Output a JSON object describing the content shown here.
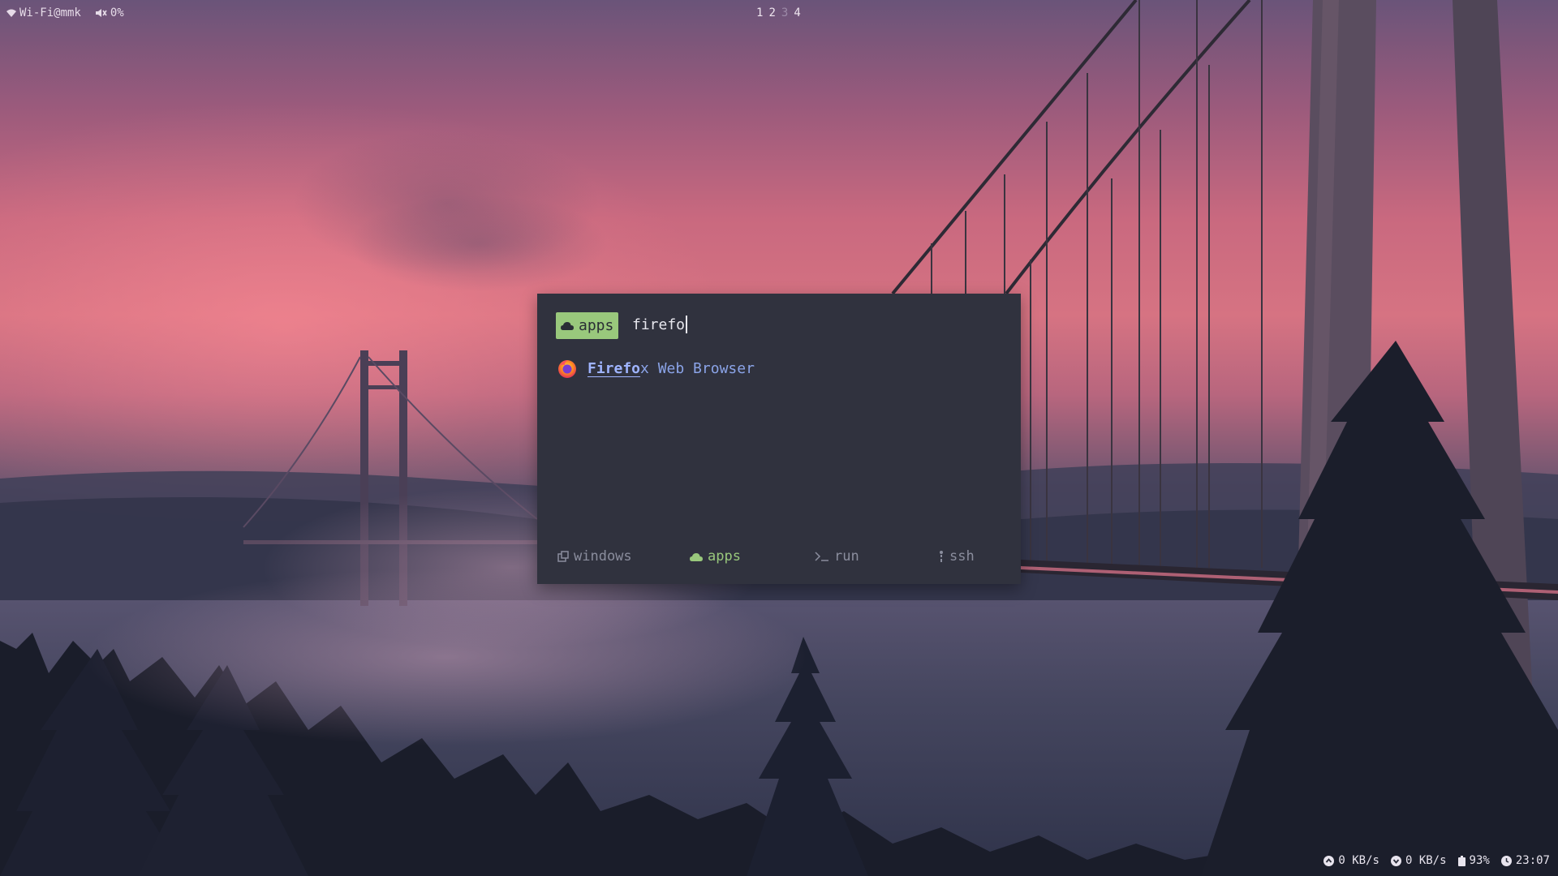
{
  "topbar": {
    "wifi_label": "Wi-Fi@mmk",
    "volume_label": "0%",
    "workspaces": [
      "1",
      "2",
      "3",
      "4"
    ],
    "active_workspace": "3"
  },
  "statusbar": {
    "upload": "0 KB/s",
    "download": "0 KB/s",
    "battery": "93%",
    "clock": "23:07"
  },
  "launcher": {
    "mode_label": "apps",
    "query": "firefo",
    "results": [
      {
        "match": "Firefo",
        "rest": "x Web Browser",
        "icon": "firefox-icon"
      }
    ],
    "tabs": [
      {
        "label": "windows",
        "icon": "windows-icon"
      },
      {
        "label": "apps",
        "icon": "cloud-icon",
        "active": true
      },
      {
        "label": "run",
        "icon": "terminal-icon"
      },
      {
        "label": "ssh",
        "icon": "ssh-icon"
      }
    ]
  },
  "colors": {
    "launcher_bg": "#30323e",
    "accent_green": "#99c87c",
    "result_blue": "#8ba4e8"
  }
}
